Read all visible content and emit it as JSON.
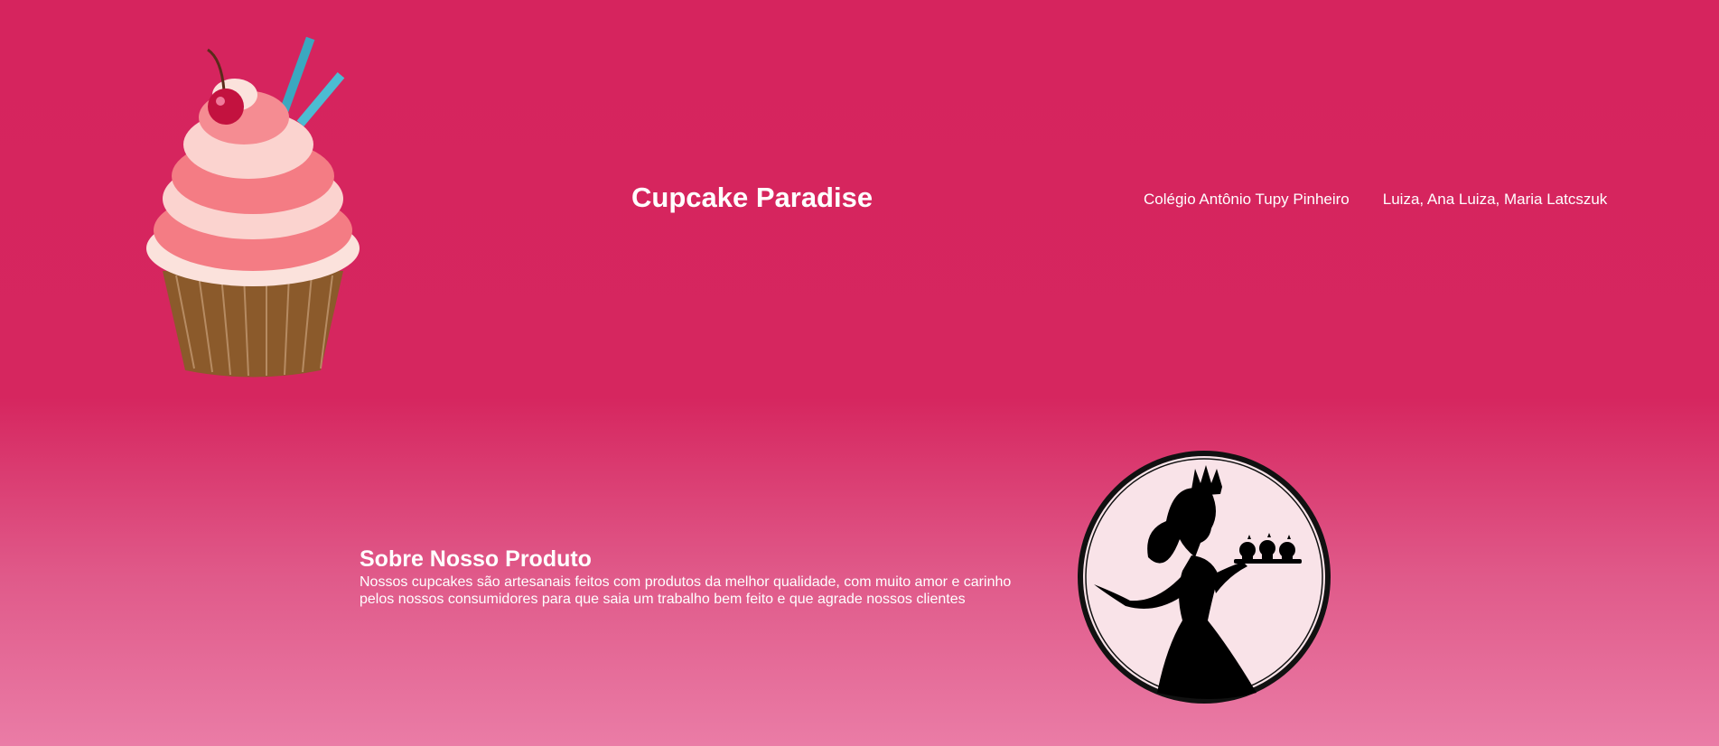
{
  "header": {
    "title": "Cupcake Paradise",
    "nav": [
      "Colégio Antônio Tupy Pinheiro",
      "Luiza, Ana Luiza, Maria Latcszuk"
    ]
  },
  "about": {
    "heading": "Sobre Nosso Produto",
    "text": "Nossos cupcakes são artesanais feitos com produtos da melhor qualidade, com muito amor e carinho pelos nossos consumidores para que saia um trabalho bem feito e que agrade nossos clientes"
  },
  "images": {
    "logo": "cupcake-logo-icon",
    "illustration": "princess-silhouette-icon"
  },
  "colors": {
    "background_top": "#d6245e",
    "background_bottom": "#ea7ca6",
    "frosting": "#f47c84",
    "cherry": "#c3123f",
    "straw": "#3ba8c0",
    "wrapper": "#8b5a2b",
    "medallion": "#f9e3e8"
  }
}
